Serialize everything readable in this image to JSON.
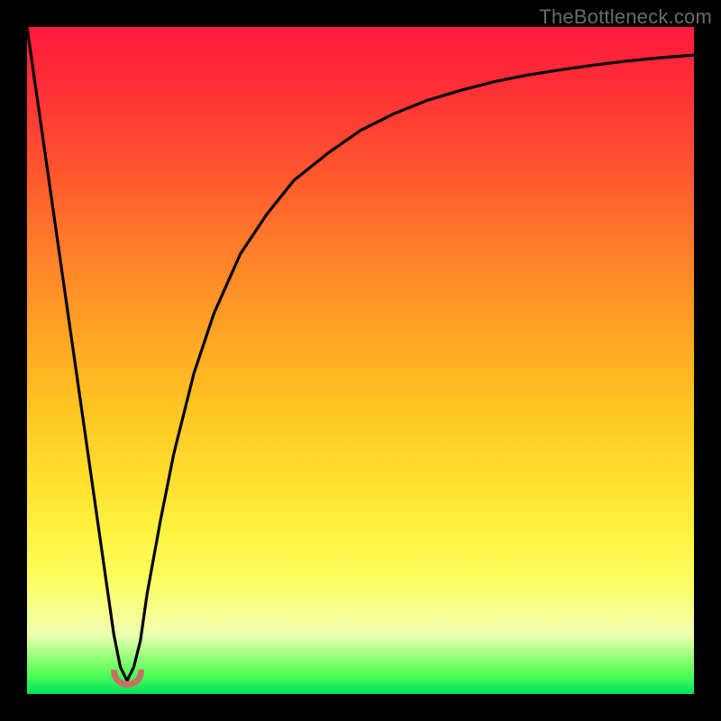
{
  "watermark": "TheBottleneck.com",
  "chart_data": {
    "type": "line",
    "title": "",
    "xlabel": "",
    "ylabel": "",
    "xlim": [
      0,
      100
    ],
    "ylim": [
      0,
      100
    ],
    "x": [
      0,
      2,
      4,
      6,
      8,
      10,
      12,
      13,
      14,
      15,
      16,
      17,
      18,
      20,
      22,
      25,
      28,
      32,
      36,
      40,
      45,
      50,
      55,
      60,
      65,
      70,
      75,
      80,
      85,
      90,
      95,
      100
    ],
    "values": [
      100,
      86,
      72,
      58,
      44,
      30,
      16,
      9,
      4,
      2,
      4,
      8,
      15,
      26,
      36,
      48,
      57,
      66,
      72,
      77,
      81,
      84.5,
      87,
      89,
      90.5,
      91.8,
      92.8,
      93.6,
      94.3,
      94.9,
      95.4,
      95.8
    ],
    "marker": {
      "x_center": 15,
      "width_pct": 5,
      "y": 2
    },
    "gradient_stops": [
      {
        "pos": 0,
        "color": "#ff1a3c"
      },
      {
        "pos": 0.5,
        "color": "#ffd030"
      },
      {
        "pos": 0.83,
        "color": "#fcff60"
      },
      {
        "pos": 1,
        "color": "#00e060"
      }
    ]
  }
}
